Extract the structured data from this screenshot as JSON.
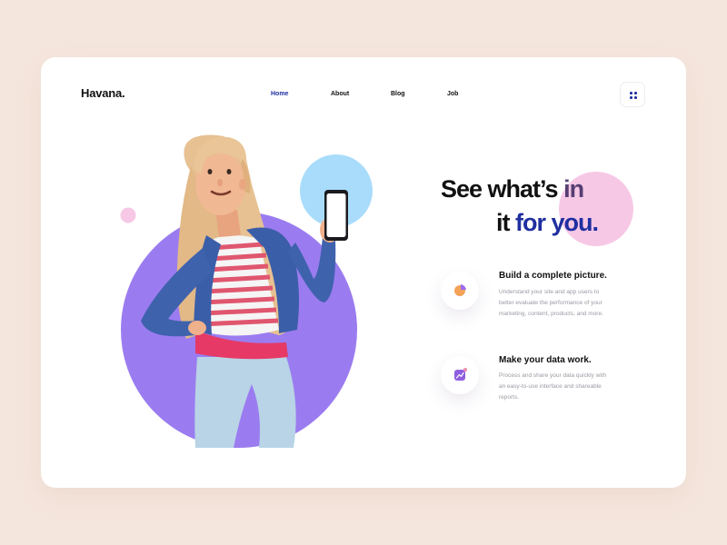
{
  "brand": {
    "logo": "Havana."
  },
  "nav": {
    "items": [
      {
        "label": "Home",
        "active": true
      },
      {
        "label": "About",
        "active": false
      },
      {
        "label": "Blog",
        "active": false
      },
      {
        "label": "Job",
        "active": false
      }
    ]
  },
  "menu_button": {
    "icon": "grid-dots-icon"
  },
  "hero": {
    "headline_line1_a": "See what’s ",
    "headline_line1_b": "in",
    "headline_line2_a": "it ",
    "headline_line2_b": "for you."
  },
  "features": [
    {
      "icon": "pie-chart-icon",
      "title": "Build a complete picture.",
      "description": "Understand your site and app users to better evaluate the performance of your marketing, content, products, and more."
    },
    {
      "icon": "trend-chart-icon",
      "title": "Make your data work.",
      "description": "Process and share your data quickly with an easy-to-use interface and shareable reports."
    }
  ],
  "colors": {
    "background": "#f5e6dd",
    "primary_blue": "#1f2fa0",
    "purple_circle": "#9b7cf0",
    "light_blue_circle": "#a9dcfb",
    "pink_circle": "#f7c8e6"
  }
}
